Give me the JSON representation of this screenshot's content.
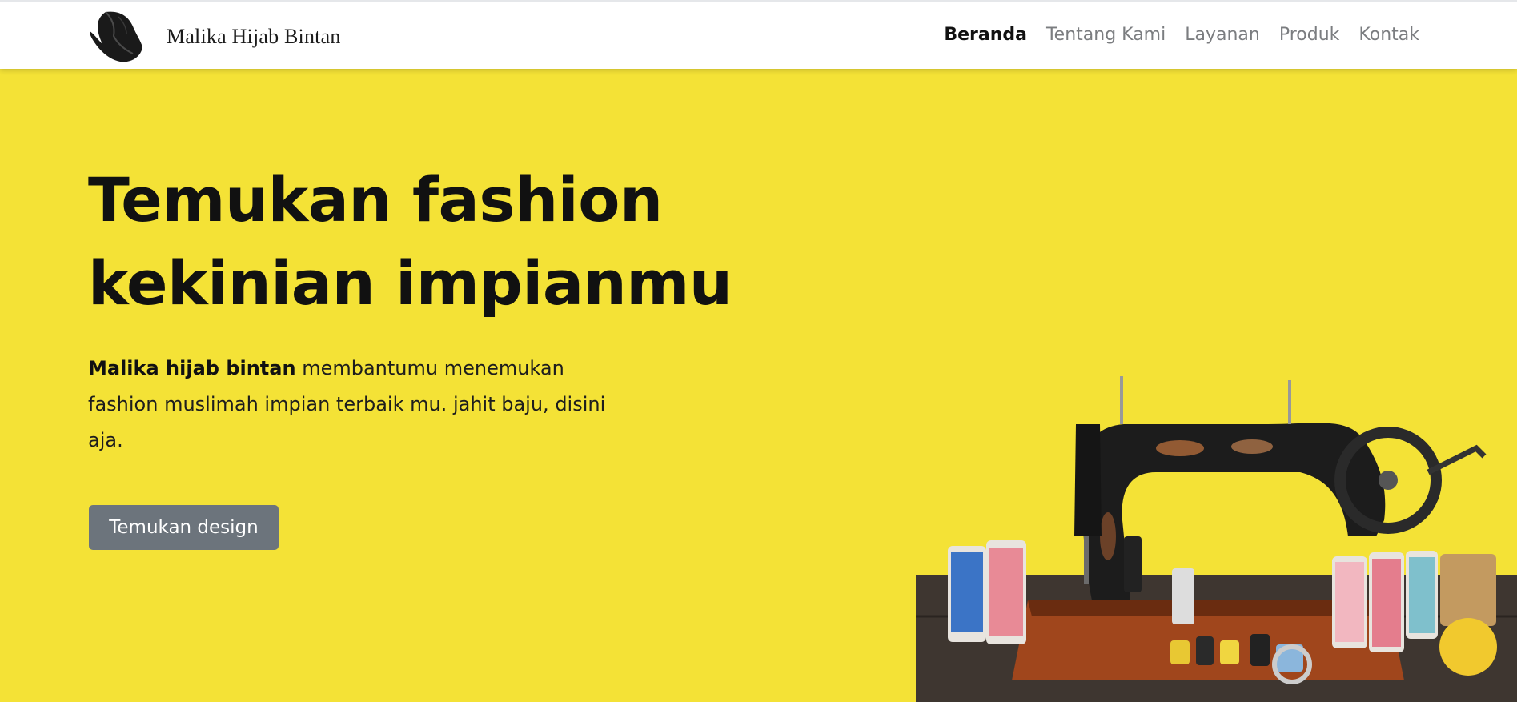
{
  "brand": {
    "name": "Malika Hijab Bintan",
    "logo_icon": "hijab-silhouette-icon"
  },
  "nav": {
    "items": [
      {
        "label": "Beranda",
        "active": true
      },
      {
        "label": "Tentang Kami",
        "active": false
      },
      {
        "label": "Layanan",
        "active": false
      },
      {
        "label": "Produk",
        "active": false
      },
      {
        "label": "Kontak",
        "active": false
      }
    ]
  },
  "hero": {
    "title_line1": "Temukan fashion",
    "title_line2": "kekinian impianmu",
    "desc_bold": "Malika hijab bintan",
    "desc_text": " membantumu menemukan fashion muslimah impian terbaik mu. jahit baju, disini aja.",
    "cta_label": "Temukan design",
    "image_icon": "sewing-machine-illustration"
  },
  "colors": {
    "hero_background": "#f4e236",
    "navbar_background": "#ffffff",
    "cta_background": "#6c747c",
    "nav_active": "#111111",
    "nav_inactive": "#7b7d80"
  }
}
